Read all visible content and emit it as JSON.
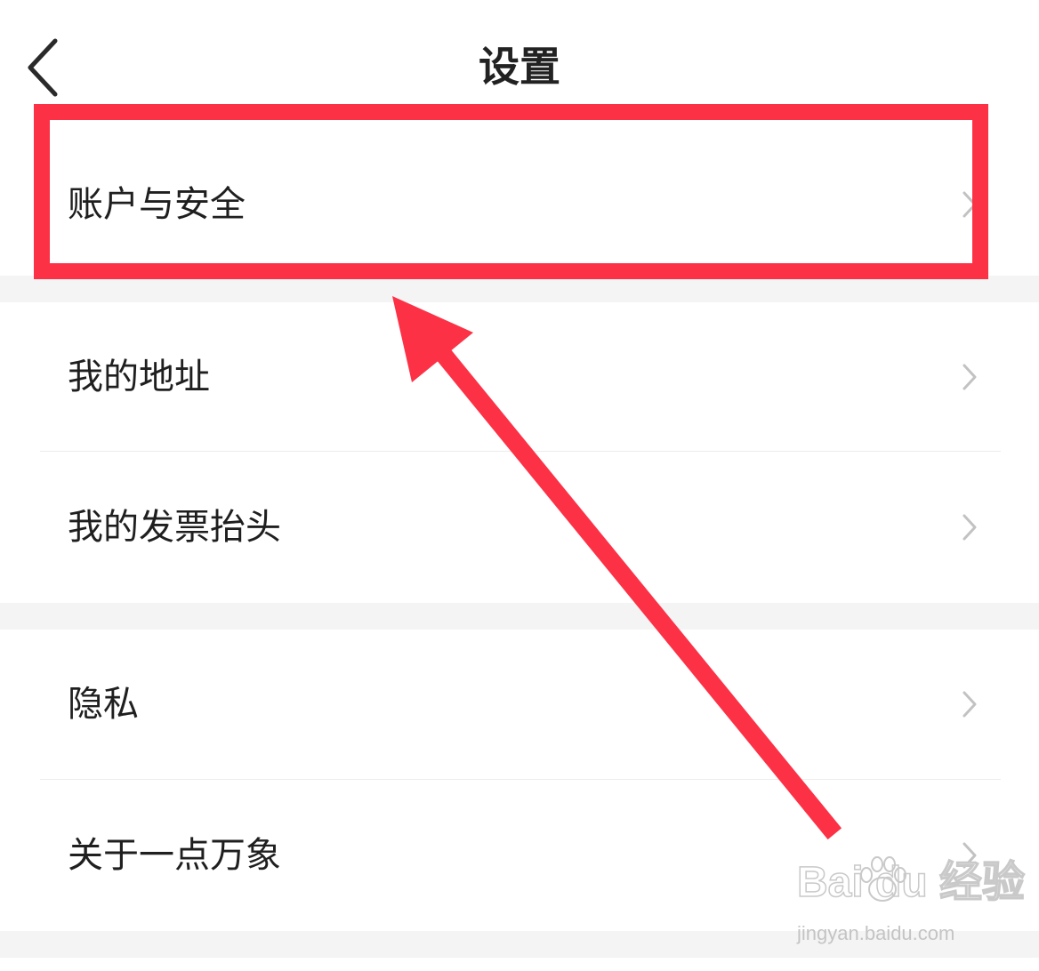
{
  "header": {
    "title": "设置",
    "back_icon": "chevron-left-icon"
  },
  "settings": {
    "items": [
      {
        "label": "账户与安全",
        "icon": "chevron-right-icon"
      },
      {
        "label": "我的地址",
        "icon": "chevron-right-icon"
      },
      {
        "label": "我的发票抬头",
        "icon": "chevron-right-icon"
      },
      {
        "label": "隐私",
        "icon": "chevron-right-icon"
      },
      {
        "label": "关于一点万象",
        "icon": "chevron-right-icon"
      }
    ]
  },
  "annotation": {
    "color": "#fd3146",
    "target": "账户与安全"
  },
  "watermark": {
    "logo": "Bai du 经验",
    "url": "jingyan.baidu.com"
  },
  "colors": {
    "background": "#ffffff",
    "section_gap": "#f4f4f4",
    "text": "#1f1f1f",
    "chevron": "#c2c2c2",
    "accent": "#fd3146"
  }
}
